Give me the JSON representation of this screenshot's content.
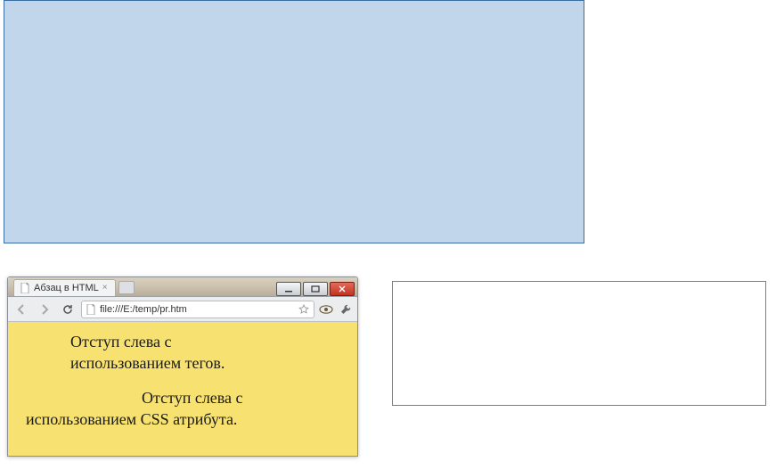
{
  "browser": {
    "tab_title": "Абзац в HTML",
    "url": "file:///E:/temp/pr.htm",
    "page": {
      "para1": "Отступ слева с использованием тегов.",
      "para2_line1": "Отступ слева с",
      "para2_line2": "использованием CSS атрибута."
    }
  }
}
